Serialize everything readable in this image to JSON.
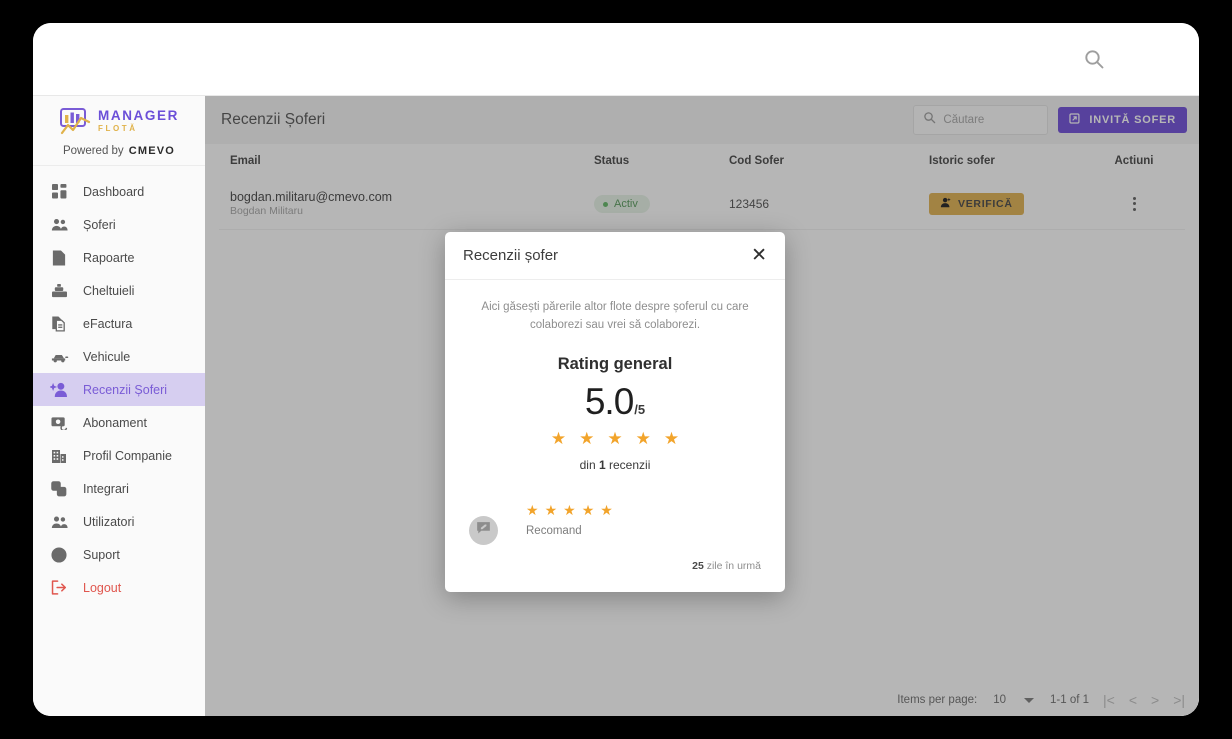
{
  "browser": {
    "search_icon": "search-icon",
    "menu_icon": "hamburger-menu-icon"
  },
  "sidebar": {
    "logo": {
      "title": "MANAGER",
      "subtitle": "FLOTĂ"
    },
    "powered_by": {
      "prefix": "Powered by",
      "brand": "CMEVO"
    },
    "items": [
      {
        "label": "Dashboard",
        "icon": "grid-dashboard-icon",
        "active": false,
        "danger": false
      },
      {
        "label": "Șoferi",
        "icon": "people-icon",
        "active": false,
        "danger": false
      },
      {
        "label": "Rapoarte",
        "icon": "document-icon",
        "active": false,
        "danger": false
      },
      {
        "label": "Cheltuieli",
        "icon": "cash-register-icon",
        "active": false,
        "danger": false
      },
      {
        "label": "eFactura",
        "icon": "documents-copy-icon",
        "active": false,
        "danger": false
      },
      {
        "label": "Vehicule",
        "icon": "car-icon",
        "active": false,
        "danger": false
      },
      {
        "label": "Recenzii Șoferi",
        "icon": "person-add-icon",
        "active": true,
        "danger": false
      },
      {
        "label": "Abonament",
        "icon": "money-card-icon",
        "active": false,
        "danger": false
      },
      {
        "label": "Profil Companie",
        "icon": "building-icon",
        "active": false,
        "danger": false
      },
      {
        "label": "Integrari",
        "icon": "integrations-icon",
        "active": false,
        "danger": false
      },
      {
        "label": "Utilizatori",
        "icon": "users-icon",
        "active": false,
        "danger": false
      },
      {
        "label": "Suport",
        "icon": "globe-support-icon",
        "active": false,
        "danger": false
      },
      {
        "label": "Logout",
        "icon": "logout-icon",
        "active": false,
        "danger": true
      }
    ]
  },
  "page": {
    "title": "Recenzii Șoferi",
    "search": {
      "placeholder": "Căutare",
      "value": "",
      "icon": "search-icon"
    },
    "invite_button": {
      "label": "INVITĂ SOFER",
      "icon": "invite-icon"
    }
  },
  "table": {
    "headers": {
      "email": "Email",
      "status": "Status",
      "cod": "Cod Sofer",
      "istoric": "Istoric sofer",
      "actiuni": "Actiuni"
    },
    "rows": [
      {
        "email": "bogdan.militaru@cmevo.com",
        "name": "Bogdan Militaru",
        "status": "Activ",
        "cod": "123456",
        "istoric_button": "VERIFICĂ",
        "actions_icon": "kebab-menu-icon"
      }
    ]
  },
  "paginator": {
    "items_per_page_label": "Items per page:",
    "items_per_page_value": "10",
    "range_label": "1-1 of 1",
    "first_icon": "first-page-icon",
    "prev_icon": "prev-page-icon",
    "next_icon": "next-page-icon",
    "last_icon": "last-page-icon"
  },
  "modal": {
    "title": "Recenzii șofer",
    "close_icon": "close-icon",
    "description": "Aici găsești părerile altor flote despre șoferul cu care colaborezi sau vrei să colaborezi.",
    "rating_label": "Rating general",
    "score": "5.0",
    "score_suffix": "/5",
    "stars_filled": 5,
    "count_prefix": "din",
    "count_value": "1",
    "count_suffix": "recenzii",
    "reviews": [
      {
        "stars": 5,
        "text": "Recomand",
        "time_value": "25",
        "time_suffix": "zile în urmă",
        "avatar_icon": "comment-icon"
      }
    ]
  },
  "colors": {
    "accent_purple": "#5c36d4",
    "star_orange": "#f2a42b",
    "verify_gold": "#dda73a",
    "active_green": "#4caf50",
    "logout_red": "#e0564e"
  }
}
